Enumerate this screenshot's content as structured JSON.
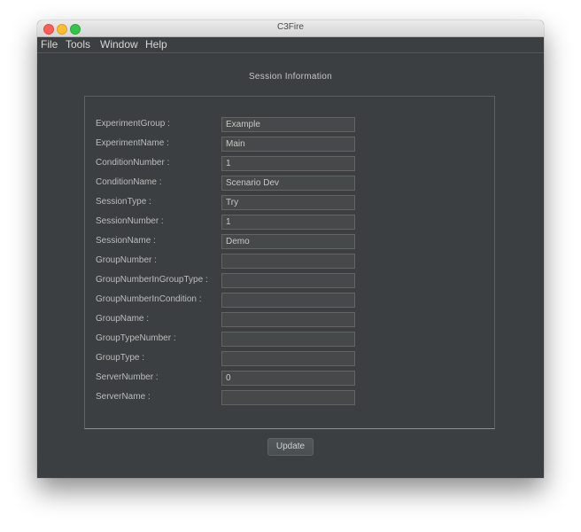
{
  "window": {
    "title": "C3Fire"
  },
  "menubar": {
    "items": [
      "File",
      "Tools",
      "Window",
      "Help"
    ]
  },
  "panel": {
    "heading": "Session Information"
  },
  "form": {
    "fields": [
      {
        "label": "ExperimentGroup :",
        "value": ""
      },
      {
        "label": "ExperimentName :",
        "value": "Main"
      },
      {
        "label": "ConditionNumber :",
        "value": "1"
      },
      {
        "label": "ConditionName :",
        "value": "Scenario Dev"
      },
      {
        "label": "SessionType :",
        "value": "Try"
      },
      {
        "label": "SessionNumber :",
        "value": "1"
      },
      {
        "label": "SessionName :",
        "value": "Demo"
      },
      {
        "label": "GroupNumber :",
        "value": ""
      },
      {
        "label": "GroupNumberInGroupType :",
        "value": ""
      },
      {
        "label": "GroupNumberInCondition :",
        "value": ""
      },
      {
        "label": "GroupName :",
        "value": ""
      },
      {
        "label": "GroupTypeNumber :",
        "value": ""
      },
      {
        "label": "GroupType :",
        "value": ""
      },
      {
        "label": "ServerNumber :",
        "value": "0"
      },
      {
        "label": "ServerName :",
        "value": ""
      }
    ]
  },
  "actions": {
    "update_label": "Update"
  },
  "fixes": {
    "first_value": "Example"
  }
}
